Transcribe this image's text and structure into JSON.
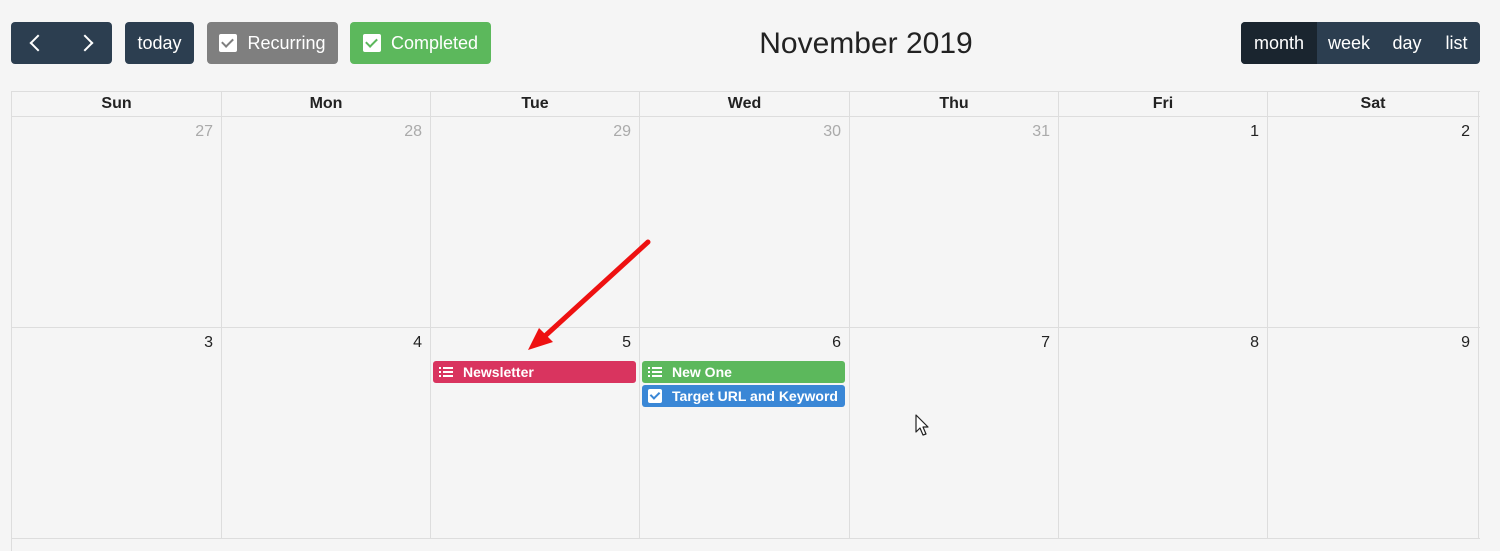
{
  "toolbar": {
    "prev_icon": "chevron-left-icon",
    "next_icon": "chevron-right-icon",
    "today_label": "today",
    "recurring_label": "Recurring",
    "completed_label": "Completed",
    "title": "November 2019",
    "views": [
      "month",
      "week",
      "day",
      "list"
    ],
    "active_view": "month"
  },
  "weekdays": [
    "Sun",
    "Mon",
    "Tue",
    "Wed",
    "Thu",
    "Fri",
    "Sat"
  ],
  "weeks": [
    {
      "days": [
        {
          "num": "27",
          "other": true
        },
        {
          "num": "28",
          "other": true
        },
        {
          "num": "29",
          "other": true
        },
        {
          "num": "30",
          "other": true
        },
        {
          "num": "31",
          "other": true
        },
        {
          "num": "1",
          "other": false
        },
        {
          "num": "2",
          "other": false
        }
      ]
    },
    {
      "days": [
        {
          "num": "3",
          "other": false
        },
        {
          "num": "4",
          "other": false
        },
        {
          "num": "5",
          "other": false
        },
        {
          "num": "6",
          "other": false
        },
        {
          "num": "7",
          "other": false
        },
        {
          "num": "8",
          "other": false
        },
        {
          "num": "9",
          "other": false
        }
      ]
    }
  ],
  "events": [
    {
      "title": "Newsletter",
      "day": "5",
      "icon": "list-icon",
      "color": "#d9345f"
    },
    {
      "title": "New One",
      "day": "6",
      "icon": "list-icon",
      "color": "#5cb85c"
    },
    {
      "title": "Target URL and Keyword",
      "day": "6",
      "icon": "checkbox-icon",
      "color": "#3a87d6"
    }
  ],
  "colors": {
    "toolbar_button": "#2c3e50",
    "recurring_button": "#7f7f7f",
    "completed_button": "#5cb85c",
    "annotation_arrow": "#ee1111"
  }
}
